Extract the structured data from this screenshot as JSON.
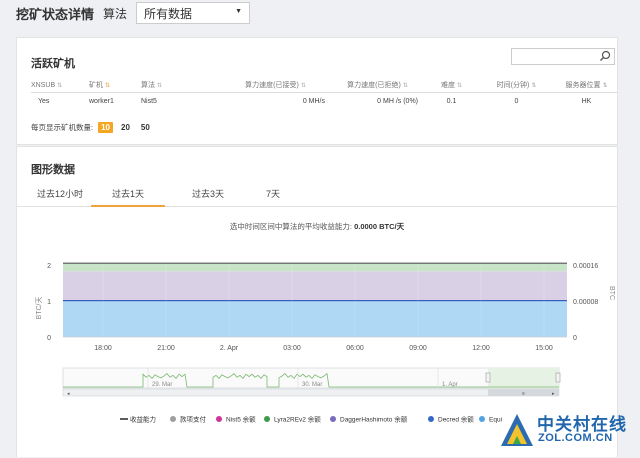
{
  "header": {
    "title": "挖矿状态详情",
    "algo_label": "算法",
    "algo_value": "所有数据"
  },
  "active_miners": {
    "title": "活跃矿机",
    "search_placeholder": "",
    "columns": [
      "XNSUB",
      "矿机",
      "算法",
      "算力速度(已接受)",
      "算力速度(已拒绝)",
      "难度",
      "时间(分钟)",
      "服务器位置"
    ],
    "rows": [
      [
        "Yes",
        "worker1",
        "Nist5",
        "0 MH/s",
        "0 MH /s (0%)",
        "0.1",
        "0",
        "HK"
      ]
    ],
    "per_page_label": "每页显示矿机数量:",
    "per_page_options": [
      "10",
      "20",
      "50"
    ],
    "per_page_selected": "10"
  },
  "graph": {
    "title": "图形数据",
    "tabs": [
      "过去12小时",
      "过去1天",
      "过去3天",
      "7天"
    ],
    "active_tab": "过去1天",
    "caption_prefix": "选中时间区间中算法的平均收益能力: ",
    "caption_value": "0.0000 BTC/天"
  },
  "chart_data": {
    "type": "area",
    "x_labels": [
      "18:00",
      "21:00",
      "2. Apr",
      "03:00",
      "06:00",
      "09:00",
      "12:00",
      "15:00"
    ],
    "y_left_ticks": [
      "0",
      "1",
      "2"
    ],
    "y_right_ticks": [
      "0",
      "0.00008",
      "0.00016"
    ],
    "y_left_label": "BTC/天",
    "y_right_label": "BTC",
    "y_left_range": [
      0,
      2
    ],
    "y_right_range": [
      0,
      0.00016
    ],
    "bands_right_units": [
      {
        "name": "Equihash",
        "from": 0,
        "to": 8e-05,
        "color": "#aed8f3"
      },
      {
        "name": "Decred",
        "from": 8e-05,
        "to": 8.2e-05,
        "color": "#3b6fd1"
      },
      {
        "name": "DaggerHashimoto",
        "from": 8.2e-05,
        "to": 0.000146,
        "color": "#d9d0e6"
      },
      {
        "name": "Lyra2REv2",
        "from": 0.000146,
        "to": 0.000164,
        "color": "#c8e4c8"
      }
    ],
    "navigator_labels": [
      "29. Mar",
      "30. Mar",
      "1. Apr"
    ],
    "legend": [
      {
        "name": "收益能力",
        "color": "#333333",
        "type": "line"
      },
      {
        "name": "款项支付",
        "color": "#9e9e9e",
        "type": "dot"
      },
      {
        "name": "Nist5 余额",
        "color": "#d0339a",
        "type": "dot"
      },
      {
        "name": "Lyra2REv2 余额",
        "color": "#3f9a4b",
        "type": "dot"
      },
      {
        "name": "DaggerHashimoto 余额",
        "color": "#7b6bbd",
        "type": "dot"
      },
      {
        "name": "Decred 余额",
        "color": "#3468c8",
        "type": "dot"
      },
      {
        "name": "Equi",
        "color": "#4ea3e0",
        "type": "dot"
      }
    ]
  },
  "watermark": {
    "main": "中关村在线",
    "sub": "ZOL.COM.CN"
  },
  "colors": {
    "accent": "#f5a623",
    "zol_blue": "#2166ad"
  }
}
